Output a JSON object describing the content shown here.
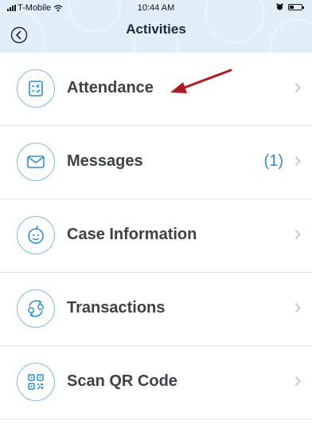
{
  "status_bar": {
    "carrier": "T-Mobile",
    "time": "10:44 AM"
  },
  "header": {
    "title": "Activities",
    "background": "#e2effa"
  },
  "accent_color": "#2b8fd6",
  "annotation_color": "#b01c1c",
  "menu": [
    {
      "label": "Attendance",
      "icon": "attendance-calendar-icon",
      "badge": ""
    },
    {
      "label": "Messages",
      "icon": "envelope-icon",
      "badge": "(1)"
    },
    {
      "label": "Case Information",
      "icon": "child-face-icon",
      "badge": ""
    },
    {
      "label": "Transactions",
      "icon": "transactions-exchange-icon",
      "badge": ""
    },
    {
      "label": "Scan QR Code",
      "icon": "qr-code-icon",
      "badge": ""
    }
  ]
}
